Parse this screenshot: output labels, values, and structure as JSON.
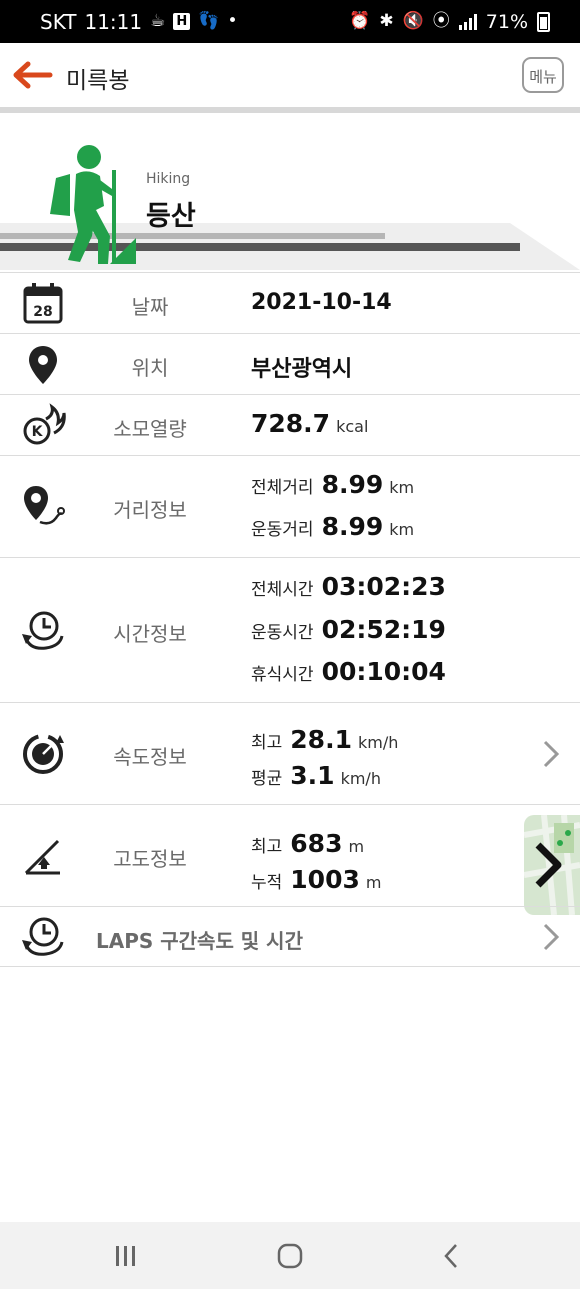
{
  "status_bar": {
    "carrier": "SKT",
    "time": "11:11",
    "battery_percent": "71%"
  },
  "app_bar": {
    "title": "미륵봉",
    "menu_label": "메뉴"
  },
  "activity": {
    "name_en": "Hiking",
    "name_ko": "등산",
    "icon": "hiker-icon"
  },
  "rows": {
    "date": {
      "label": "날짜",
      "value": "2021-10-14",
      "icon_day": "28"
    },
    "location": {
      "label": "위치",
      "value": "부산광역시"
    },
    "calories": {
      "label": "소모열량",
      "value": "728.7",
      "unit": "kcal"
    },
    "distance": {
      "label": "거리정보",
      "lines": [
        {
          "label": "전체거리",
          "value": "8.99",
          "unit": "km"
        },
        {
          "label": "운동거리",
          "value": "8.99",
          "unit": "km"
        }
      ]
    },
    "time": {
      "label": "시간정보",
      "lines": [
        {
          "label": "전체시간",
          "value": "03:02:23"
        },
        {
          "label": "운동시간",
          "value": "02:52:19"
        },
        {
          "label": "휴식시간",
          "value": "00:10:04"
        }
      ]
    },
    "speed": {
      "label": "속도정보",
      "lines": [
        {
          "label": "최고",
          "value": "28.1",
          "unit": "km/h"
        },
        {
          "label": "평균",
          "value": "3.1",
          "unit": "km/h"
        }
      ]
    },
    "altitude": {
      "label": "고도정보",
      "lines": [
        {
          "label": "최고",
          "value": "683",
          "unit": "m"
        },
        {
          "label": "누적",
          "value": "1003",
          "unit": "m"
        }
      ]
    },
    "laps": {
      "label": "LAPS 구간속도 및 시간"
    }
  },
  "colors": {
    "accent": "#d9481c",
    "hiker_green": "#22a04a",
    "label_gray": "#6a6a6a"
  }
}
